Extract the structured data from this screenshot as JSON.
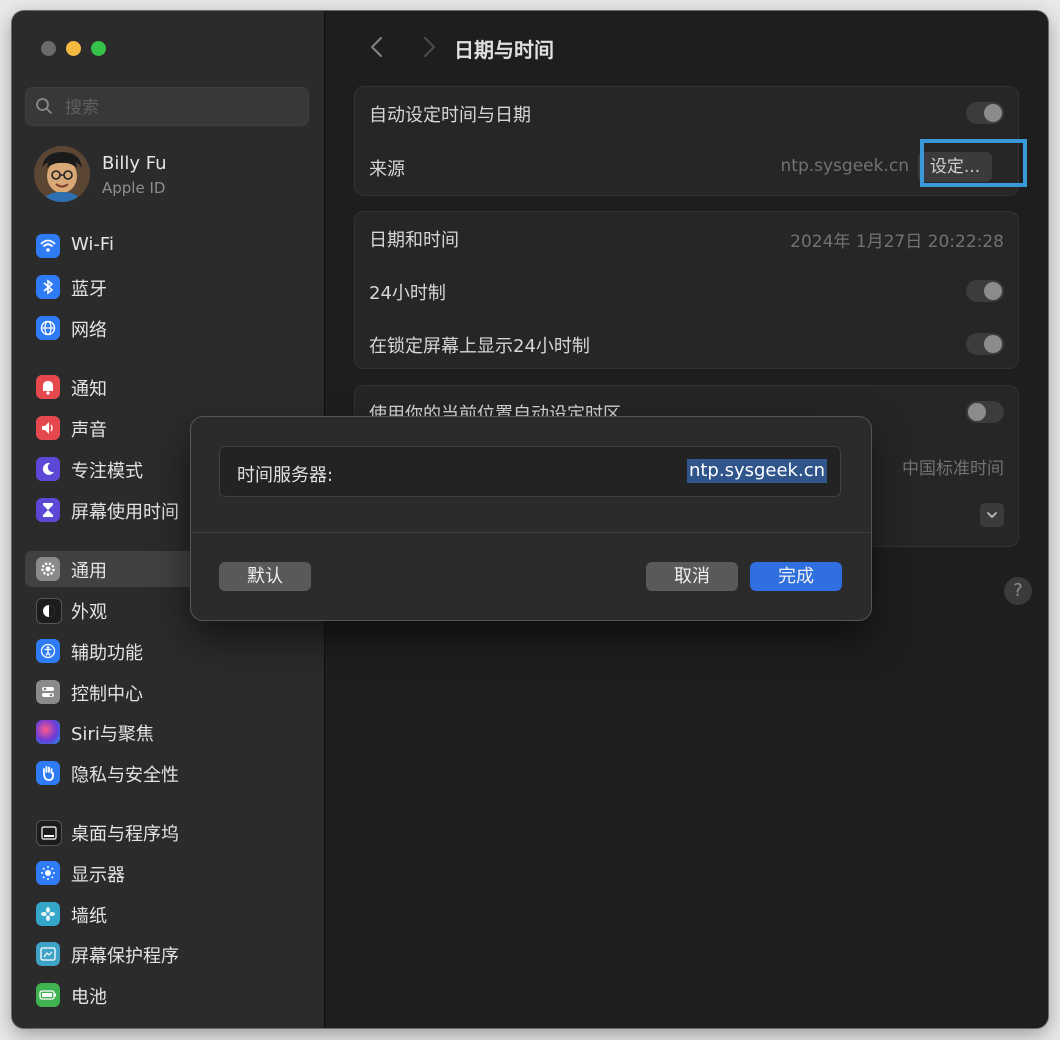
{
  "sidebar": {
    "search_placeholder": "搜索",
    "profile": {
      "name": "Billy Fu",
      "subtitle": "Apple ID"
    },
    "items": [
      {
        "label": "Wi-Fi",
        "icon": "wifi-icon",
        "color": "#2f7bf6"
      },
      {
        "label": "蓝牙",
        "icon": "bluetooth-icon",
        "color": "#2f7bf6"
      },
      {
        "label": "网络",
        "icon": "globe-icon",
        "color": "#2f7bf6"
      },
      {
        "label": "通知",
        "icon": "bell-icon",
        "color": "#e5484d"
      },
      {
        "label": "声音",
        "icon": "speaker-icon",
        "color": "#e5484d"
      },
      {
        "label": "专注模式",
        "icon": "moon-icon",
        "color": "#5b49d6"
      },
      {
        "label": "屏幕使用时间",
        "icon": "hourglass-icon",
        "color": "#5b49d6"
      },
      {
        "label": "通用",
        "icon": "gear-icon",
        "color": "#8a8a8d",
        "selected": true
      },
      {
        "label": "外观",
        "icon": "appearance-icon",
        "color": "#1c1c1e"
      },
      {
        "label": "辅助功能",
        "icon": "accessibility-icon",
        "color": "#2f7bf6"
      },
      {
        "label": "控制中心",
        "icon": "switches-icon",
        "color": "#8a8a8d"
      },
      {
        "label": "Siri与聚焦",
        "icon": "siri-icon",
        "color": "#9b4bd9"
      },
      {
        "label": "隐私与安全性",
        "icon": "hand-icon",
        "color": "#2f7bf6"
      },
      {
        "label": "桌面与程序坞",
        "icon": "dock-icon",
        "color": "#1c1c1e"
      },
      {
        "label": "显示器",
        "icon": "sun-icon",
        "color": "#2f7bf6"
      },
      {
        "label": "墙纸",
        "icon": "flower-icon",
        "color": "#33a6c9"
      },
      {
        "label": "屏幕保护程序",
        "icon": "screensaver-icon",
        "color": "#3fa3c6"
      },
      {
        "label": "电池",
        "icon": "battery-icon",
        "color": "#3fb34f"
      }
    ]
  },
  "header": {
    "title": "日期与时间"
  },
  "groups": {
    "auto": {
      "auto_label": "自动设定时间与日期",
      "auto_on": true,
      "source_label": "来源",
      "source_value": "ntp.sysgeek.cn",
      "set_button": "设定..."
    },
    "datetime": {
      "date_label": "日期和时间",
      "date_value": "2024年 1月27日 20:22:28",
      "h24_label": "24小时制",
      "h24_on": true,
      "lock_label": "在锁定屏幕上显示24小时制",
      "lock_on": true
    },
    "timezone": {
      "auto_tz_label": "使用你的当前位置自动设定时区",
      "auto_tz_on": false,
      "tz_value": "中国标准时间"
    }
  },
  "dialog": {
    "field_label": "时间服务器:",
    "field_value": "ntp.sysgeek.cn",
    "default_button": "默认",
    "cancel_button": "取消",
    "done_button": "完成"
  },
  "help_label": "?"
}
